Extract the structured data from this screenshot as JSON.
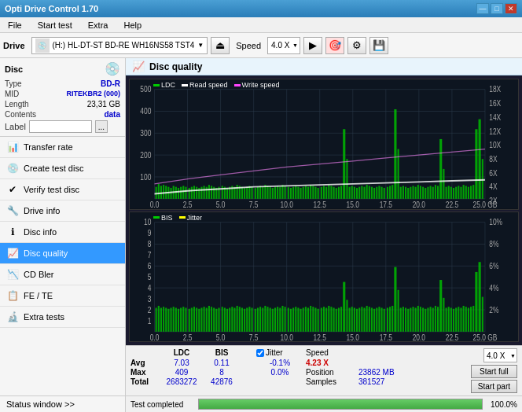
{
  "titlebar": {
    "title": "Opti Drive Control 1.70",
    "min_btn": "—",
    "max_btn": "□",
    "close_btn": "✕"
  },
  "menu": {
    "items": [
      "File",
      "Start test",
      "Extra",
      "Help"
    ]
  },
  "toolbar": {
    "drive_label": "Drive",
    "drive_name": "(H:) HL-DT-ST BD-RE  WH16NS58 TST4",
    "speed_label": "Speed",
    "speed_value": "4.0 X"
  },
  "disc_panel": {
    "title": "Disc",
    "type_label": "Type",
    "type_val": "BD-R",
    "mid_label": "MID",
    "mid_val": "RITEKBR2 (000)",
    "length_label": "Length",
    "length_val": "23,31 GB",
    "contents_label": "Contents",
    "contents_val": "data",
    "label_label": "Label",
    "label_val": ""
  },
  "nav": {
    "items": [
      {
        "id": "transfer-rate",
        "label": "Transfer rate",
        "icon": "📊"
      },
      {
        "id": "create-test-disc",
        "label": "Create test disc",
        "icon": "💿"
      },
      {
        "id": "verify-test-disc",
        "label": "Verify test disc",
        "icon": "✔"
      },
      {
        "id": "drive-info",
        "label": "Drive info",
        "icon": "🔧"
      },
      {
        "id": "disc-info",
        "label": "Disc info",
        "icon": "ℹ"
      },
      {
        "id": "disc-quality",
        "label": "Disc quality",
        "icon": "📈",
        "active": true
      },
      {
        "id": "cd-bler",
        "label": "CD Bler",
        "icon": "📉"
      },
      {
        "id": "fe-te",
        "label": "FE / TE",
        "icon": "📋"
      },
      {
        "id": "extra-tests",
        "label": "Extra tests",
        "icon": "🔬"
      }
    ],
    "status_window": "Status window >>"
  },
  "disc_quality": {
    "title": "Disc quality",
    "chart1": {
      "legend": [
        {
          "label": "LDC",
          "color": "#00aa00"
        },
        {
          "label": "Read speed",
          "color": "#ffffff"
        },
        {
          "label": "Write speed",
          "color": "#ff00ff"
        }
      ],
      "y_labels": [
        "18X",
        "16X",
        "14X",
        "12X",
        "10X",
        "8X",
        "6X",
        "4X",
        "2X"
      ],
      "y_values": [
        500,
        400,
        300,
        200,
        100
      ],
      "x_labels": [
        "0.0",
        "2.5",
        "5.0",
        "7.5",
        "10.0",
        "12.5",
        "15.0",
        "17.5",
        "20.0",
        "22.5",
        "25.0 GB"
      ]
    },
    "chart2": {
      "legend": [
        {
          "label": "BIS",
          "color": "#00aa00"
        },
        {
          "label": "Jitter",
          "color": "#ffff00"
        }
      ],
      "y_labels_left": [
        "10",
        "9",
        "8",
        "7",
        "6",
        "5",
        "4",
        "3",
        "2",
        "1"
      ],
      "y_labels_right": [
        "10%",
        "8%",
        "6%",
        "4%",
        "2%"
      ],
      "x_labels": [
        "0.0",
        "2.5",
        "5.0",
        "7.5",
        "10.0",
        "12.5",
        "15.0",
        "17.5",
        "20.0",
        "22.5",
        "25.0 GB"
      ]
    },
    "stats": {
      "headers": [
        "",
        "LDC",
        "BIS",
        "",
        "Jitter",
        "Speed",
        ""
      ],
      "avg_label": "Avg",
      "avg_ldc": "7.03",
      "avg_bis": "0.11",
      "avg_jitter": "-0.1%",
      "max_label": "Max",
      "max_ldc": "409",
      "max_bis": "8",
      "max_jitter": "0.0%",
      "total_label": "Total",
      "total_ldc": "2683272",
      "total_bis": "42876",
      "jitter_checked": true,
      "jitter_label": "Jitter",
      "speed_label": "Speed",
      "speed_val": "4.23 X",
      "speed_sel": "4.0 X",
      "position_label": "Position",
      "position_val": "23862 MB",
      "samples_label": "Samples",
      "samples_val": "381527",
      "start_full": "Start full",
      "start_part": "Start part"
    }
  },
  "progress": {
    "label": "Test completed",
    "percent": 100,
    "percent_label": "100.0%"
  }
}
